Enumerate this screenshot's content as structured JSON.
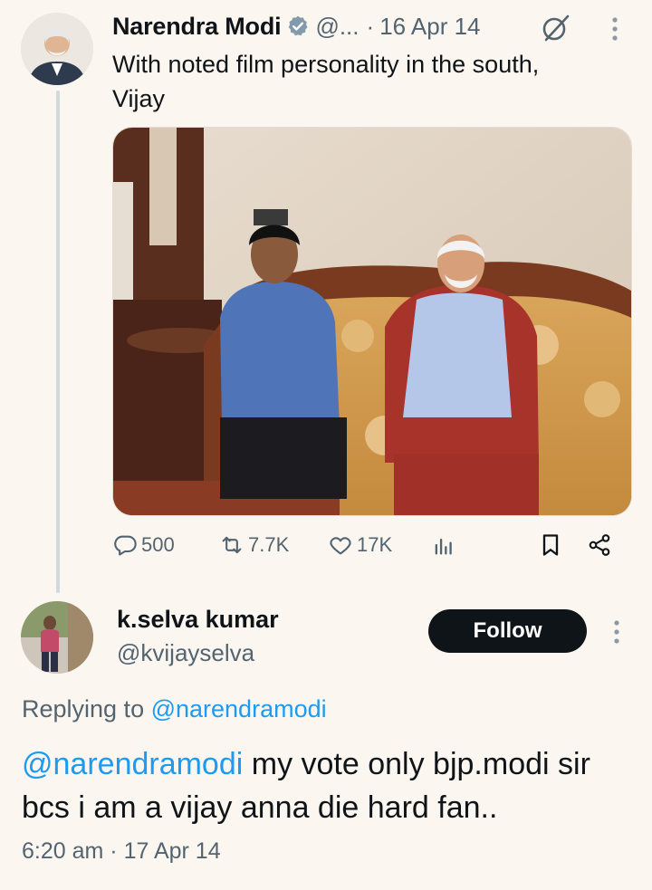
{
  "tweet": {
    "author_name": "Narendra Modi",
    "handle": "@...",
    "separator": "·",
    "date": "16 Apr 14",
    "text_line1": "With noted film personality in the south,",
    "text_line2": "Vijay",
    "verified_color": "#829aab",
    "stats": {
      "replies": "500",
      "retweets": "7.7K",
      "likes": "17K"
    },
    "icons": [
      "verified-badge-icon",
      "grok-icon",
      "more-options-icon",
      "reply-icon",
      "retweet-icon",
      "like-icon",
      "views-icon",
      "bookmark-icon",
      "share-icon"
    ]
  },
  "reply": {
    "author_name": "k.selva kumar",
    "handle": "@kvijayselva",
    "follow_label": "Follow",
    "replying_prefix": "Replying to ",
    "replying_handle": "@narendramodi",
    "mention": "@narendramodi",
    "text_rest": " my vote only bjp.modi sir bcs i am a vijay anna die hard fan..",
    "time": "6:20 am",
    "separator": "·",
    "date": "17 Apr 14"
  },
  "colors": {
    "background": "#fcf6f0",
    "link": "#1d9bf0",
    "secondary_text": "#536471",
    "follow_button": "#0f1419"
  }
}
